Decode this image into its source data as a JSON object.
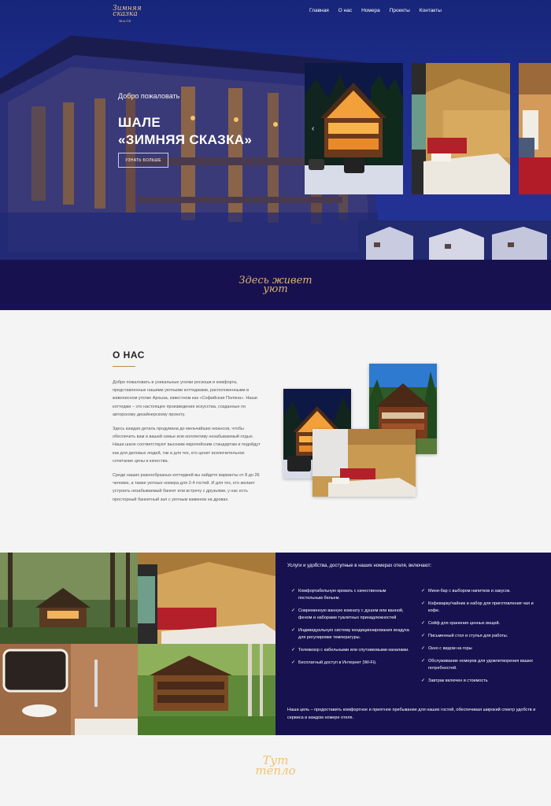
{
  "header": {
    "logo_text": "Зимняя сказка",
    "logo_sub": "ШАЛЕ",
    "nav": [
      "Главная",
      "О нас",
      "Номера",
      "Проекты",
      "Контакты"
    ]
  },
  "hero": {
    "welcome": "Добро пожаловать",
    "title_line1": "ШАЛЕ",
    "title_line2": "«ЗИМНЯЯ СКАЗКА»",
    "button": "УЗНАТЬ БОЛЬШЕ",
    "slider_prev_icon": "chevron-left-icon"
  },
  "band1": {
    "line1": "Здесь живет",
    "line2": "уют"
  },
  "about": {
    "title": "О НАС",
    "p1": "Добро пожаловать в уникальные уголки роскоши и комфорта, представленные нашими уютными коттеджами, расположенными в живописном уголке Архыза, известном как «Софийская Поляна». Наши коттеджи – это настоящее произведение искусства, созданные по авторскому дизайнерскому проекту.",
    "p2": "Здесь каждая деталь продумана до мельчайших нюансов, чтобы обеспечить вам и вашей семье или коллективу незабываемый отдых. Наши шале соответствуют высоким европейским стандартам и подойдут как для деловых людей, так и для тех, кто ценит исключительное сочетание цены и качества.",
    "p3": "Среди наших разнообразных коттеджей вы найдете варианты от 8 до 26 человек, а также уютные номера для 2-4 гостей. И для тех, кто желает устроить незабываемый банкет или встречу с друзьями, у нас есть просторный банкетный зал с уютным камином на дровах."
  },
  "amenities": {
    "heading": "Услуги и удобства, доступные в наших номерах отеля, включают:",
    "left": [
      "Комфортабельную кровать с качественным постельным бельем.",
      "Современную ванную комнату с душем или ванной, феном и наборами туалетных принадлежностей",
      "Индивидуальную систему кондиционирования воздуха для регулировки температуры.",
      "Телевизор с кабельными или спутниковыми каналами.",
      "Бесплатный доступ в Интернет (Wi-Fi)."
    ],
    "right": [
      "Мини-бар с выбором напитков и закусок.",
      "Кофеварку/чайник и набор для приготовления чая и кофе.",
      "Сейф для хранения ценных вещей.",
      "Письменный стол и стулья для работы.",
      "Окно с видом на горы",
      "Обслуживание номеров для удовлетворения ваших потребностей.",
      "Завтрак включен в стоимость"
    ],
    "check_icon": "check-icon",
    "goal": "Наша цель – предоставить комфортное и приятное пребывание для наших гостей, обеспечивая широкий спектр удобств и сервиса в каждом номере отеля."
  },
  "band2": {
    "line1": "Тут",
    "line2": "тепло"
  },
  "colors": {
    "hero_blue": "#1f2f8e",
    "band_navy": "#17124f",
    "accent_gold": "#e0b36c"
  }
}
